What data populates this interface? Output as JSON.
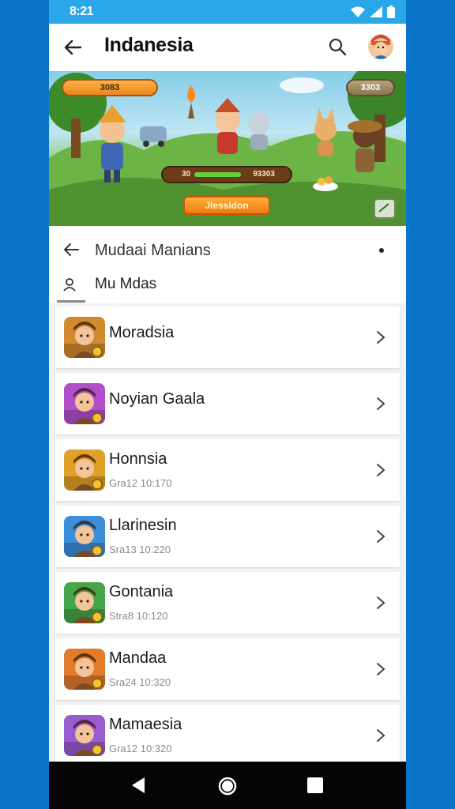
{
  "status_bar": {
    "time": "8:21",
    "icons": [
      "wifi-icon",
      "signal-icon",
      "battery-icon"
    ]
  },
  "app_bar": {
    "title": "Indanesia",
    "icons": [
      "back-arrow-icon",
      "search-icon",
      "avatar"
    ]
  },
  "banner": {
    "coin_chip": "3083",
    "gem_chip": "3303",
    "progress": {
      "left_label": "30",
      "right_label": "93303",
      "fraction": 0.7
    },
    "cta_label": "Jlessldon"
  },
  "sub_header": {
    "title": "Mudaai Manians",
    "user_label": "Mu Mdas"
  },
  "list": {
    "items": [
      {
        "name": "Moradsia",
        "meta": "",
        "theme": "#d28a2f"
      },
      {
        "name": "Noyian Gaala",
        "meta": "",
        "theme": "#b04fc9"
      },
      {
        "name": "Honnsia",
        "meta": "Gra12 10:170",
        "theme": "#e0a128"
      },
      {
        "name": "Llarinesin",
        "meta": "Sra13 10:220",
        "theme": "#3b8ed8"
      },
      {
        "name": "Gontania",
        "meta": "Stra8 10:120",
        "theme": "#46a44a"
      },
      {
        "name": "Mandaa",
        "meta": "Sra24 10:320",
        "theme": "#e27b2c"
      },
      {
        "name": "Mamaesia",
        "meta": "Gra12 10:320",
        "theme": "#9a5ad0"
      }
    ]
  },
  "nav_bar": {
    "icons": [
      "nav-back-icon",
      "nav-home-icon",
      "nav-recents-icon"
    ]
  }
}
